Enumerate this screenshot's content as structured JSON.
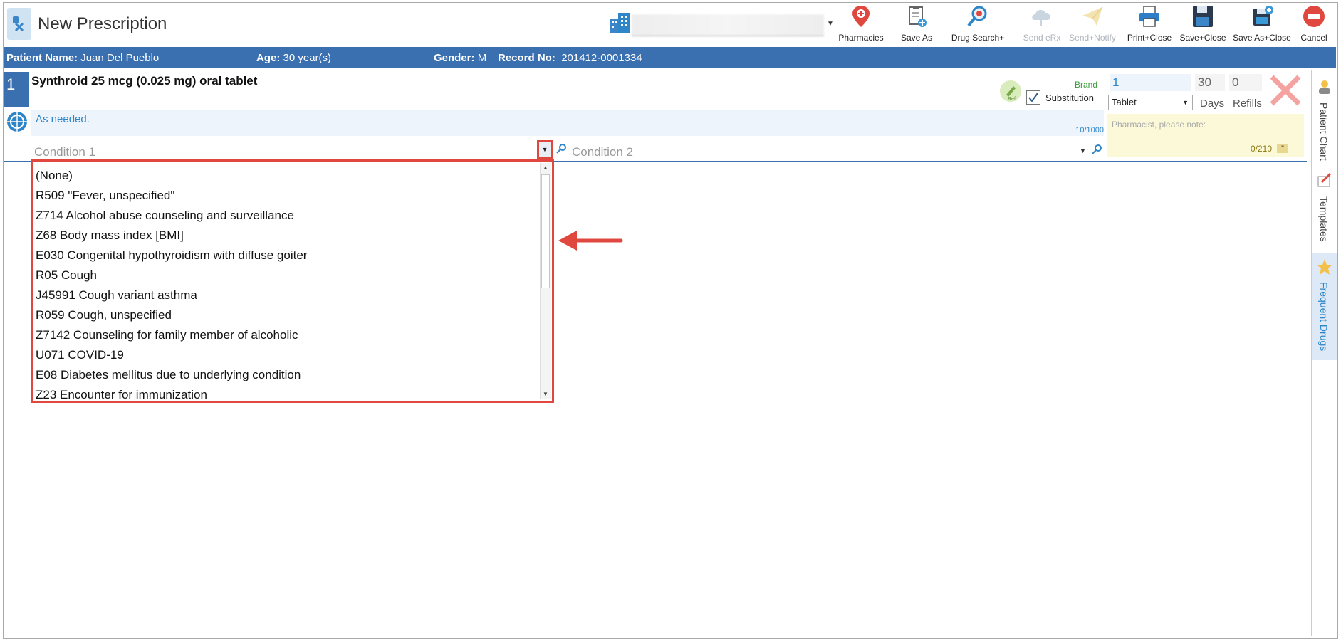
{
  "window": {
    "title": "New Prescription"
  },
  "toolbar": {
    "buttons": [
      {
        "label": "Pharmacies",
        "icon": "map-pin-icon",
        "enabled": true
      },
      {
        "label": "Save As",
        "icon": "clipboard-add-icon",
        "enabled": true
      },
      {
        "label": "Drug Search+",
        "icon": "drug-search-icon",
        "enabled": true
      },
      {
        "label": "Send eRx",
        "icon": "cloud-send-icon",
        "enabled": false
      },
      {
        "label": "Send+Notify",
        "icon": "paper-plane-icon",
        "enabled": false
      },
      {
        "label": "Print+Close",
        "icon": "printer-icon",
        "enabled": true
      },
      {
        "label": "Save+Close",
        "icon": "floppy-disk-icon",
        "enabled": true
      },
      {
        "label": "Save As+Close",
        "icon": "save-as-close-icon",
        "enabled": true
      },
      {
        "label": "Cancel",
        "icon": "cancel-icon",
        "enabled": true
      }
    ]
  },
  "patient": {
    "name_label": "Patient Name:",
    "name": "Juan Del Pueblo",
    "age_label": "Age:",
    "age": "30 year(s)",
    "gender_label": "Gender:",
    "gender": "M",
    "record_label": "Record No:",
    "record": "201412-0001334"
  },
  "prescription": {
    "number": "1",
    "drug_name": "Synthroid 25 mcg (0.025 mg) oral tablet",
    "sig": "As needed.",
    "sig_count": "10/1000",
    "brand_label": "Brand",
    "substitution_label": "Substitution",
    "substitution_checked": true,
    "quantity": "1",
    "unit": "Tablet",
    "days": "30",
    "days_label": "Days",
    "refills": "0",
    "refills_label": "Refills",
    "pharmacist_note_placeholder": "Pharmacist, please note:",
    "pharmacist_note_count": "0/210",
    "note_quote_icon": "quote-icon"
  },
  "conditions": {
    "condition1_placeholder": "Condition 1",
    "condition2_placeholder": "Condition 2",
    "dropdown_items": [
      "(None)",
      "R509 \"Fever, unspecified\"",
      "Z714 Alcohol abuse counseling and surveillance",
      "Z68 Body mass index [BMI]",
      "E030 Congenital hypothyroidism with diffuse goiter",
      "R05 Cough",
      "J45991 Cough variant asthma",
      "R059 Cough, unspecified",
      "Z7142 Counseling for family member of alcoholic",
      "U071 COVID-19",
      "E08 Diabetes mellitus due to underlying condition",
      "Z23 Encounter for immunization"
    ]
  },
  "side_tabs": [
    {
      "label": "Patient Chart",
      "icon": "patient-chart-icon",
      "active": false
    },
    {
      "label": "Templates",
      "icon": "templates-icon",
      "active": false
    },
    {
      "label": "Frequent Drugs",
      "icon": "star-icon",
      "active": true
    }
  ],
  "colors": {
    "accent_blue": "#3a6fb0",
    "highlight_red": "#e0483f",
    "link_blue": "#2e86c8",
    "note_yellow": "#fcf9d9"
  }
}
